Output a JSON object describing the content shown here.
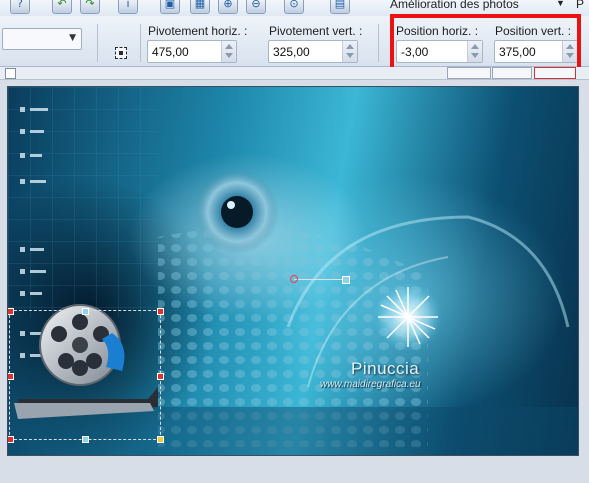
{
  "menu": {
    "enhance_label": "Amélioration des photos",
    "right_edge_label": "P"
  },
  "toolbar": {
    "icons": [
      "help-icon",
      "undo-icon",
      "redo-icon",
      "info-icon",
      "image-icon",
      "grid-icon",
      "zoom-in-icon",
      "zoom-out-icon",
      "zoom-fit-icon",
      "page-icon"
    ]
  },
  "tool_options": {
    "pivot_h_label": "Pivotement horiz. :",
    "pivot_h_value": "475,00",
    "pivot_v_label": "Pivotement vert. :",
    "pivot_v_value": "325,00",
    "pos_h_label": "Position horiz. :",
    "pos_h_value": "-3,00",
    "pos_v_label": "Position vert. :",
    "pos_v_value": "375,00"
  },
  "canvas": {
    "brand_name": "Pinuccia",
    "brand_url": "www.maidiregrafica.eu"
  },
  "colors": {
    "highlight": "#ee1111",
    "panel_bg": "#dfe8f3",
    "canvas_accent": "#2aa6cf"
  }
}
